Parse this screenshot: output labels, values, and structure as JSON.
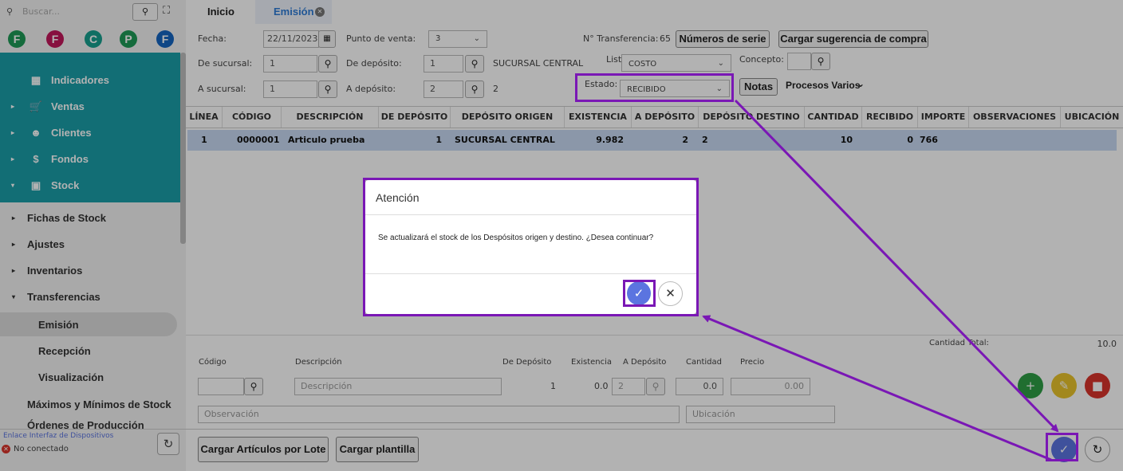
{
  "sidebar": {
    "search_placeholder": "Buscar...",
    "avatars": [
      "F",
      "F",
      "C",
      "P",
      "F"
    ],
    "avatar_colors": [
      "#1f9a56",
      "#c2185b",
      "#17a08f",
      "#1f9a56",
      "#1565c0"
    ],
    "teal_items": [
      {
        "label": "Indicadores",
        "caret": "",
        "icon": "grid-icon"
      },
      {
        "label": "Ventas",
        "caret": "▸",
        "icon": "cart-icon"
      },
      {
        "label": "Clientes",
        "caret": "▸",
        "icon": "people-icon"
      },
      {
        "label": "Fondos",
        "caret": "▸",
        "icon": "dollar-icon"
      },
      {
        "label": "Stock",
        "caret": "▾",
        "icon": "box-icon"
      }
    ],
    "menu_items": [
      {
        "label": "Fichas de Stock",
        "caret": "▸"
      },
      {
        "label": "Ajustes",
        "caret": "▸"
      },
      {
        "label": "Inventarios",
        "caret": "▸"
      },
      {
        "label": "Transferencias",
        "caret": "▾"
      }
    ],
    "sub_items": [
      "Emisión",
      "Recepción",
      "Visualización"
    ],
    "extra_item": "Máximos y Mínimos de Stock",
    "cut_item": "Órdenes de Producción",
    "device_link": "Enlace Interfaz de Dispositivos",
    "device_status": "No conectado"
  },
  "tabs": {
    "home": "Inicio",
    "active": "Emisión"
  },
  "form": {
    "fecha_label": "Fecha:",
    "fecha_value": "22/11/2023",
    "punto_label": "Punto de venta:",
    "punto_value": "3",
    "transfer_label": "N° Transferencia:",
    "transfer_value": "65",
    "serial_btn": "Números de serie",
    "suggest_btn": "Cargar sugerencia de compra",
    "de_sucursal_label": "De sucursal:",
    "de_sucursal_value": "1",
    "de_deposito_label": "De depósito:",
    "de_deposito_value": "1",
    "de_deposito_name": "SUCURSAL CENTRAL",
    "lista_label": "Lista:",
    "lista_value": "COSTO",
    "concepto_label": "Concepto:",
    "a_sucursal_label": "A sucursal:",
    "a_sucursal_value": "1",
    "a_deposito_label": "A depósito:",
    "a_deposito_value": "2",
    "a_deposito_name": "2",
    "estado_label": "Estado:",
    "estado_value": "RECIBIDO",
    "notas_btn": "Notas",
    "procesos": "Procesos Varios"
  },
  "table": {
    "headers": [
      "LÍNEA",
      "CÓDIGO",
      "DESCRIPCIÓN",
      "DE DEPÓSITO",
      "DEPÓSITO ORIGEN",
      "EXISTENCIA",
      "A DEPÓSITO",
      "DEPÓSITO DESTINO",
      "CANTIDAD",
      "RECIBIDO",
      "IMPORTE",
      "OBSERVACIONES",
      "UBICACIÓN"
    ],
    "rows": [
      [
        "1",
        "0000001",
        "Articulo prueba",
        "1",
        "SUCURSAL CENTRAL",
        "9.982",
        "2",
        "2",
        "10",
        "0",
        "766",
        "",
        ""
      ]
    ]
  },
  "totals": {
    "label": "Cantidad Total:",
    "value": "10.0"
  },
  "entry": {
    "codigo_label": "Código",
    "descripcion_label": "Descripción",
    "descripcion_placeholder": "Descripción",
    "de_deposito_label": "De Depósito",
    "existencia_label": "Existencia",
    "a_deposito_label": "A Depósito",
    "cantidad_label": "Cantidad",
    "precio_label": "Precio",
    "de_deposito_value": "1",
    "existencia_value": "0.0",
    "a_deposito_value": "2",
    "cantidad_value": "0.0",
    "precio_value": "0.00",
    "observacion_placeholder": "Observación",
    "ubicacion_placeholder": "Ubicación"
  },
  "bottom": {
    "lote_btn": "Cargar Artículos por Lote",
    "plantilla_btn": "Cargar plantilla"
  },
  "dialog": {
    "title": "Atención",
    "message": "Se actualizará el stock de los Despósitos origen y destino. ¿Desea continuar?"
  },
  "colors": {
    "teal": "#1a9ea8",
    "accent": "#2e7bd6",
    "highlight": "#7a17b5",
    "confirm": "#5b74e0",
    "row_selected": "#c7d9f2"
  }
}
